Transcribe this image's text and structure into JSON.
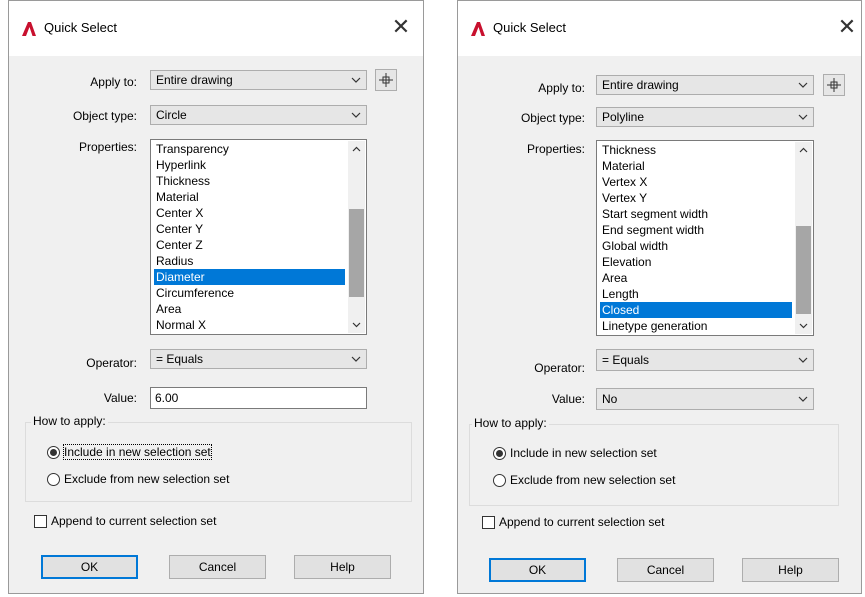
{
  "dialogs": [
    {
      "title": "Quick Select",
      "labels": {
        "apply_to": "Apply to:",
        "object_type": "Object type:",
        "properties": "Properties:",
        "operator": "Operator:",
        "value": "Value:",
        "how_to_apply": "How to apply:"
      },
      "apply_to": "Entire drawing",
      "object_type": "Circle",
      "properties": [
        "Transparency",
        "Hyperlink",
        "Thickness",
        "Material",
        "Center X",
        "Center Y",
        "Center Z",
        "Radius",
        "Diameter",
        "Circumference",
        "Area",
        "Normal X"
      ],
      "selected_property": "Diameter",
      "operator": "= Equals",
      "value": "6.00",
      "include_option": "Include in new selection set",
      "exclude_option": "Exclude from new selection set",
      "append_option": "Append to current selection set",
      "ok": "OK",
      "cancel": "Cancel",
      "help": "Help",
      "selected_mode": "include",
      "append_checked": false
    },
    {
      "title": "Quick Select",
      "labels": {
        "apply_to": "Apply to:",
        "object_type": "Object type:",
        "properties": "Properties:",
        "operator": "Operator:",
        "value": "Value:",
        "how_to_apply": "How to apply:"
      },
      "apply_to": "Entire drawing",
      "object_type": "Polyline",
      "properties": [
        "Thickness",
        "Material",
        "Vertex X",
        "Vertex Y",
        "Start segment width",
        "End segment width",
        "Global width",
        "Elevation",
        "Area",
        "Length",
        "Closed",
        "Linetype generation"
      ],
      "selected_property": "Closed",
      "operator": "= Equals",
      "value": "No",
      "include_option": "Include in new selection set",
      "exclude_option": "Exclude from new selection set",
      "append_option": "Append to current selection set",
      "ok": "OK",
      "cancel": "Cancel",
      "help": "Help",
      "selected_mode": "include",
      "append_checked": false
    }
  ],
  "colors": {
    "selection": "#0078d7",
    "dialog_bg": "#f0f0f0",
    "logo_red": "#c8102e"
  }
}
